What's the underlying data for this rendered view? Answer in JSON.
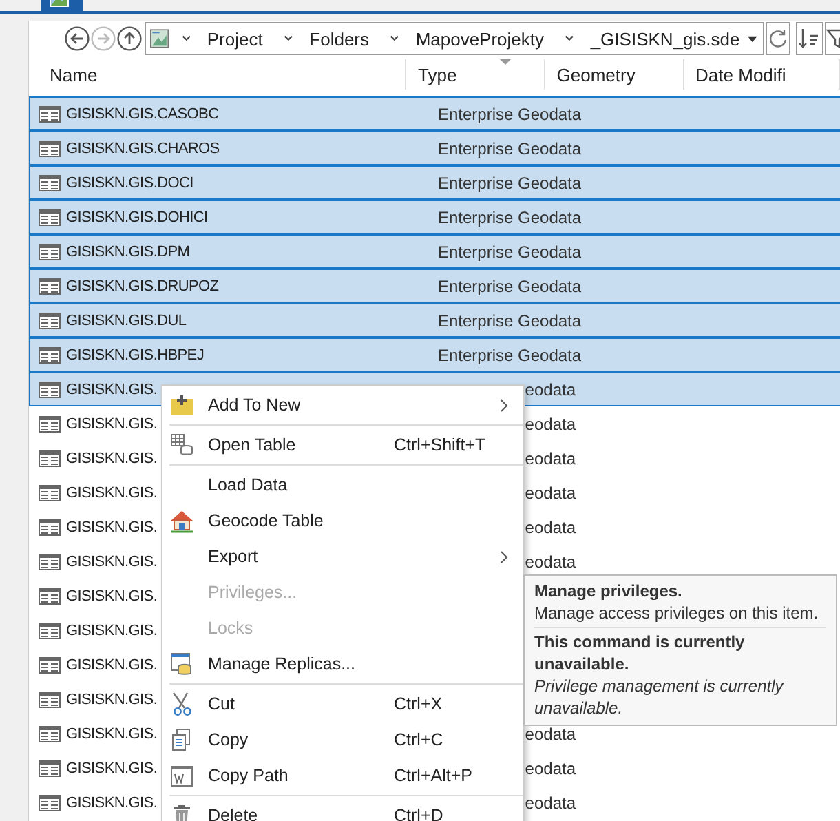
{
  "nav_buttons": [
    {
      "kind": "back",
      "disabled": false
    },
    {
      "kind": "forward",
      "disabled": true
    },
    {
      "kind": "up",
      "disabled": false
    }
  ],
  "breadcrumb": [
    "Project",
    "Folders",
    "MapoveProjekty",
    "_GISISKN_gis.sde"
  ],
  "columns": [
    "Name",
    "Type",
    "Geometry",
    "Date Modifi"
  ],
  "rows": [
    {
      "name": "GISISKN.GIS.CASOBC",
      "type": "Enterprise Geodata",
      "selected": true
    },
    {
      "name": "GISISKN.GIS.CHAROS",
      "type": "Enterprise Geodata",
      "selected": true
    },
    {
      "name": "GISISKN.GIS.DOCI",
      "type": "Enterprise Geodata",
      "selected": true
    },
    {
      "name": "GISISKN.GIS.DOHICI",
      "type": "Enterprise Geodata",
      "selected": true
    },
    {
      "name": "GISISKN.GIS.DPM",
      "type": "Enterprise Geodata",
      "selected": true
    },
    {
      "name": "GISISKN.GIS.DRUPOZ",
      "type": "Enterprise Geodata",
      "selected": true
    },
    {
      "name": "GISISKN.GIS.DUL",
      "type": "Enterprise Geodata",
      "selected": true
    },
    {
      "name": "GISISKN.GIS.HBPEJ",
      "type": "Enterprise Geodata",
      "selected": true
    },
    {
      "name": "GISISKN.GIS.",
      "type": "eodata",
      "selected": true
    },
    {
      "name": "GISISKN.GIS.",
      "type": "eodata",
      "selected": false
    },
    {
      "name": "GISISKN.GIS.",
      "type": "eodata",
      "selected": false
    },
    {
      "name": "GISISKN.GIS.",
      "type": "eodata",
      "selected": false
    },
    {
      "name": "GISISKN.GIS.",
      "type": "eodata",
      "selected": false
    },
    {
      "name": "GISISKN.GIS.",
      "type": "eodata",
      "selected": false
    },
    {
      "name": "GISISKN.GIS.",
      "selected": false
    },
    {
      "name": "GISISKN.GIS.",
      "selected": false
    },
    {
      "name": "GISISKN.GIS.",
      "selected": false
    },
    {
      "name": "GISISKN.GIS.",
      "selected": false
    },
    {
      "name": "GISISKN.GIS.",
      "type": "eodata",
      "selected": false
    },
    {
      "name": "GISISKN.GIS.",
      "type": "eodata",
      "selected": false
    },
    {
      "name": "GISISKN.GIS.",
      "type": "eodata",
      "selected": false
    }
  ],
  "context_menu": [
    {
      "label": "Add To New",
      "kind": "add",
      "submenu": true,
      "disabled": false,
      "separator_after": true
    },
    {
      "label": "Open Table",
      "kind": "open-table",
      "shortcut": "Ctrl+Shift+T",
      "submenu": false,
      "disabled": false,
      "separator_after": true
    },
    {
      "label": "Load Data",
      "kind": "plain",
      "submenu": false,
      "disabled": false,
      "separator_after": false
    },
    {
      "label": "Geocode Table",
      "kind": "geocode",
      "submenu": false,
      "disabled": false,
      "separator_after": false
    },
    {
      "label": "Export",
      "kind": "plain",
      "submenu": true,
      "disabled": false,
      "separator_after": false
    },
    {
      "label": "Privileges...",
      "kind": "plain",
      "submenu": false,
      "disabled": true,
      "separator_after": false
    },
    {
      "label": "Locks",
      "kind": "plain",
      "submenu": false,
      "disabled": true,
      "separator_after": false
    },
    {
      "label": "Manage Replicas...",
      "kind": "replicas",
      "submenu": false,
      "disabled": false,
      "separator_after": true
    },
    {
      "label": "Cut",
      "kind": "cut",
      "shortcut": "Ctrl+X",
      "submenu": false,
      "disabled": false,
      "separator_after": false
    },
    {
      "label": "Copy",
      "kind": "copy",
      "shortcut": "Ctrl+C",
      "submenu": false,
      "disabled": false,
      "separator_after": false
    },
    {
      "label": "Copy Path",
      "kind": "copy-path",
      "shortcut": "Ctrl+Alt+P",
      "submenu": false,
      "disabled": false,
      "separator_after": true
    },
    {
      "label": "Delete",
      "kind": "delete",
      "shortcut": "Ctrl+D",
      "submenu": false,
      "disabled": false,
      "separator_after": false
    }
  ],
  "tooltip": {
    "title": "Manage privileges.",
    "description": "Manage access privileges on this item.",
    "status": "This command is currently unavailable.",
    "detail": "Privilege management is currently unavailable."
  }
}
